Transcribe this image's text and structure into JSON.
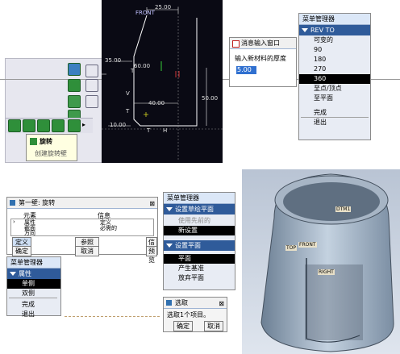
{
  "toolbar": {
    "tooltip_title": "旋转",
    "tooltip_desc": "创建旋转壁"
  },
  "sketch": {
    "front_label": "FRONT",
    "dims": {
      "top": "25.00",
      "left": "35.00",
      "inner_x": "40.00",
      "right": "50.00",
      "bottom": "10.00",
      "small": "60.00"
    },
    "h_label": "H",
    "v_label": "V",
    "t_labels": [
      "T",
      "T",
      "T"
    ]
  },
  "message_window": {
    "title": "消息输入窗口",
    "prompt": "输入新材料的厚度",
    "value": "5.00"
  },
  "menu_rev": {
    "header": "菜单管理器",
    "section": "REV TO",
    "items": [
      "可变的",
      "90",
      "180",
      "270",
      "360",
      "至点/顶点",
      "至平面",
      "完成",
      "退出"
    ],
    "selected_index": 4
  },
  "feature_dialog": {
    "title": "第一壁: 旋转",
    "col_elem": "元素",
    "col_info": "信息",
    "rows": [
      {
        "elem": "属性",
        "info": "定义"
      },
      {
        "elem": "截面",
        "info": "必需的"
      },
      {
        "elem": "方向",
        "info": ""
      }
    ],
    "buttons": [
      "定义",
      "参照",
      "信息",
      "确定",
      "取消",
      "预览"
    ]
  },
  "menu_sketch_plane": {
    "header": "菜单管理器",
    "section1": "设置草绘平面",
    "use_previous": "使用先前的",
    "new_setting": "新设置",
    "section2": "设置平面",
    "plane": "平面",
    "create_datum": "产生基准",
    "abandon": "放弃平面"
  },
  "menu_attr": {
    "header": "菜单管理器",
    "section": "属性",
    "items": [
      "单侧",
      "双侧",
      "完成",
      "退出"
    ],
    "selected_index": 0
  },
  "select_dialog": {
    "title": "选取",
    "text": "选取1个项目。",
    "ok": "确定",
    "cancel": "取消"
  },
  "model_view": {
    "labels": [
      "DTM1",
      "TOP",
      "FRONT",
      "RIGHT"
    ]
  },
  "colors": {
    "sketch_bg": "#0a0a14",
    "menu_highlight": "#2f5b9a",
    "model_bg": "#c7cfdc",
    "model_body": "#8fa3b8"
  }
}
